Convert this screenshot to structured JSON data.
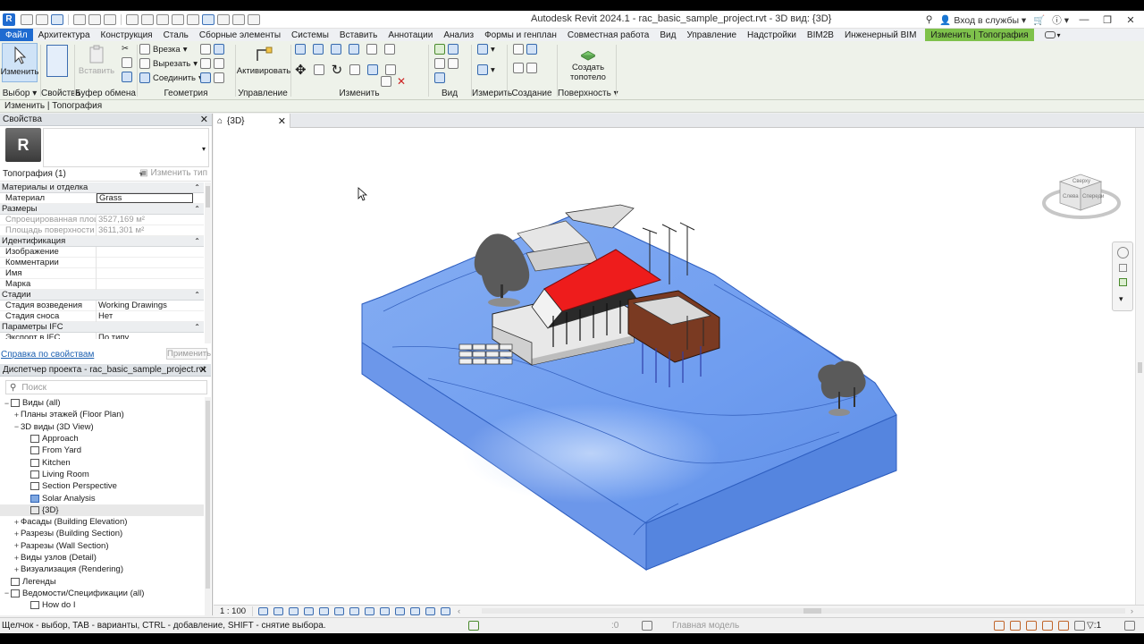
{
  "app": {
    "title": "Autodesk Revit 2024.1 - rac_basic_sample_project.rvt - 3D вид: {3D}",
    "signin": "Вход в службы",
    "help": "?"
  },
  "tabs": [
    {
      "label": "Файл",
      "kind": "file"
    },
    {
      "label": "Архитектура"
    },
    {
      "label": "Конструкция"
    },
    {
      "label": "Сталь"
    },
    {
      "label": "Сборные элементы"
    },
    {
      "label": "Системы"
    },
    {
      "label": "Вставить"
    },
    {
      "label": "Аннотации"
    },
    {
      "label": "Анализ"
    },
    {
      "label": "Формы и генплан"
    },
    {
      "label": "Совместная работа"
    },
    {
      "label": "Вид"
    },
    {
      "label": "Управление"
    },
    {
      "label": "Надстройки"
    },
    {
      "label": "BIM2B"
    },
    {
      "label": "Инженерный BIM"
    },
    {
      "label": "Изменить | Топография",
      "kind": "ctx"
    }
  ],
  "ribbon": {
    "modify_btn": "Изменить",
    "paste_btn": "Вставить",
    "activate_btn": "Активировать",
    "cut_into": "Врезка",
    "cut": "Вырезать",
    "join": "Соединить",
    "create_toposolid_line1": "Создать",
    "create_toposolid_line2": "топотело",
    "panels": {
      "select": "Выбор",
      "properties": "Свойства",
      "clipboard": "Буфер обмена",
      "geometry": "Геометрия",
      "control": "Управление",
      "modify": "Изменить",
      "view": "Вид",
      "measure": "Измерить",
      "create": "Создание",
      "surface": "Поверхность"
    }
  },
  "options_bar": "Изменить | Топография",
  "properties": {
    "title": "Свойства",
    "type_selector": "Топография (1)",
    "edit_type": "Изменить тип",
    "help_link": "Справка по свойствам",
    "apply": "Применить",
    "groups": [
      {
        "name": "Материалы и отделка",
        "rows": [
          {
            "k": "Материал",
            "v": "Grass",
            "input": true
          }
        ]
      },
      {
        "name": "Размеры",
        "rows": [
          {
            "k": "Спроецированная площадь",
            "v": "3527,169 м²",
            "dim": true
          },
          {
            "k": "Площадь поверхности",
            "v": "3611,301 м²",
            "dim": true
          }
        ]
      },
      {
        "name": "Идентификация",
        "rows": [
          {
            "k": "Изображение",
            "v": ""
          },
          {
            "k": "Комментарии",
            "v": ""
          },
          {
            "k": "Имя",
            "v": ""
          },
          {
            "k": "Марка",
            "v": ""
          }
        ]
      },
      {
        "name": "Стадии",
        "rows": [
          {
            "k": "Стадия возведения",
            "v": "Working Drawings"
          },
          {
            "k": "Стадия сноса",
            "v": "Нет"
          }
        ]
      },
      {
        "name": "Параметры IFC",
        "rows": [
          {
            "k": "Экспорт в IFC",
            "v": "По типу"
          }
        ]
      }
    ]
  },
  "browser": {
    "title": "Диспетчер проекта - rac_basic_sample_project.rvt",
    "search_placeholder": "Поиск",
    "items": [
      {
        "label": "Виды (all)",
        "level": 0,
        "toggle": "−",
        "icon": "views"
      },
      {
        "label": "Планы этажей (Floor Plan)",
        "level": 1,
        "toggle": "+"
      },
      {
        "label": "3D виды (3D View)",
        "level": 1,
        "toggle": "−"
      },
      {
        "label": "Approach",
        "level": 2,
        "icon": "view"
      },
      {
        "label": "From Yard",
        "level": 2,
        "icon": "view"
      },
      {
        "label": "Kitchen",
        "level": 2,
        "icon": "view"
      },
      {
        "label": "Living Room",
        "level": 2,
        "icon": "view"
      },
      {
        "label": "Section Perspective",
        "level": 2,
        "icon": "view"
      },
      {
        "label": "Solar Analysis",
        "level": 2,
        "icon": "view-blue"
      },
      {
        "label": "{3D}",
        "level": 2,
        "icon": "view",
        "selected": true
      },
      {
        "label": "Фасады (Building Elevation)",
        "level": 1,
        "toggle": "+"
      },
      {
        "label": "Разрезы (Building Section)",
        "level": 1,
        "toggle": "+"
      },
      {
        "label": "Разрезы (Wall Section)",
        "level": 1,
        "toggle": "+"
      },
      {
        "label": "Виды узлов (Detail)",
        "level": 1,
        "toggle": "+"
      },
      {
        "label": "Визуализация (Rendering)",
        "level": 1,
        "toggle": "+"
      },
      {
        "label": "Легенды",
        "level": 0,
        "icon": "legend"
      },
      {
        "label": "Ведомости/Спецификации (all)",
        "level": 0,
        "toggle": "−",
        "icon": "schedule"
      },
      {
        "label": "How do I",
        "level": 2,
        "icon": "schedule"
      }
    ]
  },
  "view": {
    "tab_label": "{3D}",
    "scale": "1 : 100",
    "viewcube_faces": [
      "Сверху",
      "Слева",
      "Спереди"
    ]
  },
  "status": {
    "hint": "Щелчок - выбор, TAB - варианты, CTRL - добавление, SHIFT - снятие выбора.",
    "model": "Главная модель",
    "zero": ":0",
    "filter_count": ":1"
  },
  "colors": {
    "file_tab": "#1f6bd0",
    "context_tab": "#7ec14b",
    "terrain": "#6f9df0",
    "roof": "#ee1c1c"
  }
}
